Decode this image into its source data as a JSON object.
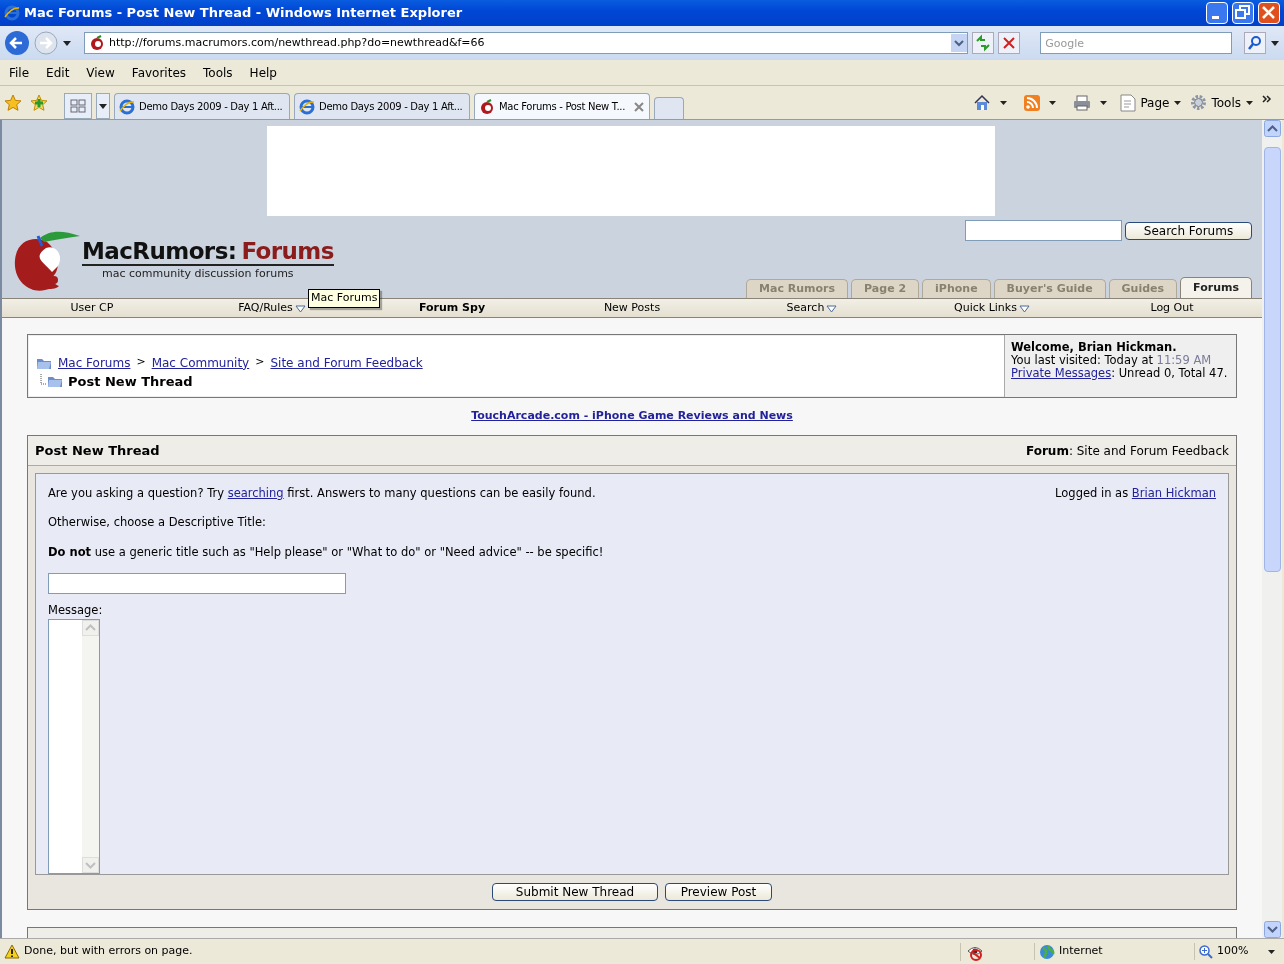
{
  "window": {
    "title": "Mac Forums - Post New Thread - Windows Internet Explorer"
  },
  "address_bar": {
    "url": "http://forums.macrumors.com/newthread.php?do=newthread&f=66",
    "search_placeholder": "Google"
  },
  "menu": [
    "File",
    "Edit",
    "View",
    "Favorites",
    "Tools",
    "Help"
  ],
  "browser_tabs": [
    {
      "label": "Demo Days 2009 - Day 1 Aft...",
      "selected": false
    },
    {
      "label": "Demo Days 2009 - Day 1 Aft...",
      "selected": false
    },
    {
      "label": "Mac Forums - Post New T...",
      "selected": true
    }
  ],
  "command_bar": [
    "Page",
    "Tools"
  ],
  "page": {
    "logo": {
      "name": "MacRumors:",
      "accent": "Forums",
      "tagline": "mac community discussion forums"
    },
    "search_button": "Search Forums",
    "tooltip": "Mac Forums",
    "site_tabs": [
      {
        "label": "Mac Rumors",
        "selected": false
      },
      {
        "label": "Page 2",
        "selected": false
      },
      {
        "label": "iPhone",
        "selected": false
      },
      {
        "label": "Buyer's Guide",
        "selected": false
      },
      {
        "label": "Guides",
        "selected": false
      },
      {
        "label": "Forums",
        "selected": true
      }
    ],
    "navbar": [
      {
        "label": "User CP",
        "dropdown": false,
        "bold": false
      },
      {
        "label": "FAQ/Rules",
        "dropdown": true,
        "bold": false
      },
      {
        "label": "Forum Spy",
        "dropdown": false,
        "bold": true
      },
      {
        "label": "New Posts",
        "dropdown": false,
        "bold": false
      },
      {
        "label": "Search",
        "dropdown": true,
        "bold": false
      },
      {
        "label": "Quick Links",
        "dropdown": true,
        "bold": false
      },
      {
        "label": "Log Out",
        "dropdown": false,
        "bold": false
      }
    ],
    "breadcrumb": {
      "links": [
        "Mac Forums",
        "Mac Community",
        "Site and Forum Feedback"
      ],
      "separator": ">",
      "current": "Post New Thread"
    },
    "welcome": {
      "greeting": "Welcome, Brian Hickman.",
      "visited_label": "You last visited: Today at",
      "visited_time": "11:59 AM",
      "messages_link": "Private Messages",
      "messages_info": ": Unread 0, Total 47."
    },
    "sponsor_link": "TouchArcade.com - iPhone Game Reviews and News",
    "form": {
      "title": "Post New Thread",
      "forum": "**Forum**: Site and Forum Feedback",
      "intro_before": "Are you asking a question? Try",
      "intro_link": "searching",
      "intro_after": "first. Answers to many questions can be easily found.",
      "logged_in_label": "Logged in as",
      "logged_in_user": "Brian Hickman",
      "title_prompt": "Otherwise, choose a Descriptive Title:",
      "warning": "**Do not** use a generic title such as \"Help please\" or \"What to do\" or \"Need advice\" -- be specific!",
      "message_label": "Message:",
      "buttons": [
        "Submit New Thread",
        "Preview Post"
      ]
    }
  },
  "status_bar": {
    "text": "Done, but with errors on page.",
    "zone": "Internet",
    "zoom": "100%"
  }
}
